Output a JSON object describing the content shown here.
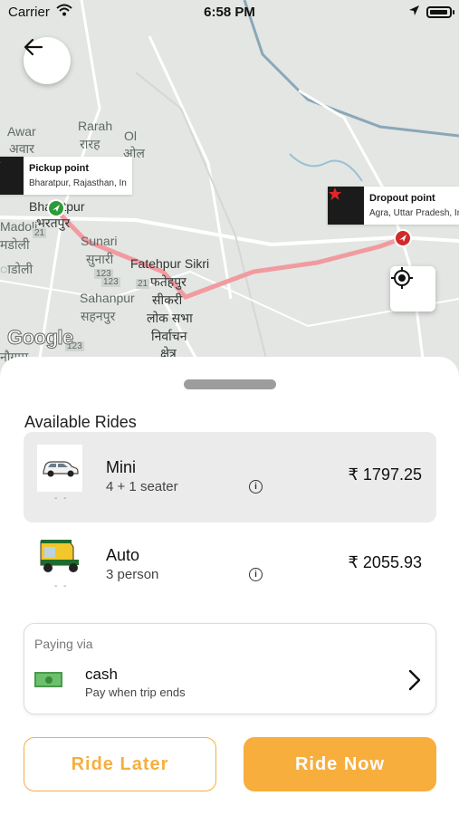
{
  "status_bar": {
    "carrier": "Carrier",
    "time": "6:58 PM"
  },
  "map": {
    "places": [
      "Rarah",
      "रारह",
      "Awar",
      "अवार",
      "Ol",
      "ओल",
      "Bharatpur",
      "भरतपुर",
      "Madoli",
      "मडोली",
      "Sunari",
      "सुनारी",
      "Fatehpur Sikri",
      "फतेहपुर",
      "सीकरी",
      "Sahanpur",
      "सहनपुर",
      "लोक सभा",
      "निर्वाचन",
      "क्षेत्र",
      "नौगाम",
      "ाडोली"
    ],
    "road_numbers": [
      "21",
      "123",
      "21",
      "123",
      "123"
    ],
    "attribution": "Google",
    "pickup": {
      "title": "Pickup point",
      "address": "Bharatpur, Rajasthan, In"
    },
    "dropoff": {
      "title": "Dropout point",
      "address": "Agra, Uttar Pradesh, In"
    },
    "route_color": "#f19ba0"
  },
  "sheet": {
    "title": "Available Rides",
    "rides": [
      {
        "name": "Mini",
        "capacity": "4 + 1 seater",
        "price": "₹ 1797.25",
        "icon": "car-icon",
        "selected": true
      },
      {
        "name": "Auto",
        "capacity": "3 person",
        "price": "₹ 2055.93",
        "icon": "auto-rickshaw-icon",
        "selected": false
      }
    ],
    "payment": {
      "label": "Paying via",
      "method": "cash",
      "note": "Pay when trip ends"
    },
    "buttons": {
      "later": "Ride Later",
      "now": "Ride Now"
    }
  },
  "colors": {
    "accent": "#f7ae3d",
    "selected_bg": "#ebebeb"
  }
}
